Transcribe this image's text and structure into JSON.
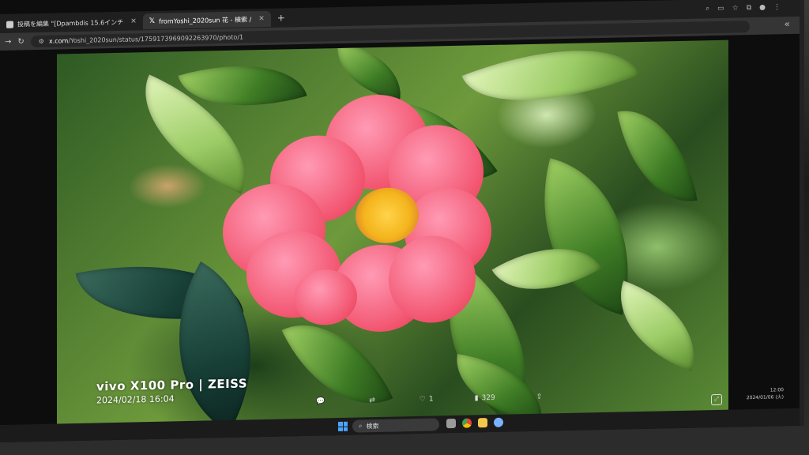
{
  "browser": {
    "tabs": [
      {
        "label": "投稿を編集 \"[Dpambdis 15.6インチ",
        "active": false
      },
      {
        "label": "fromYoshi_2020sun 花 - 検索 /",
        "active": true
      }
    ],
    "new_tab": "+",
    "url_prefix": "x.com",
    "url_rest": "/Yoshi_2020sun/status/1759173969092263970/photo/1",
    "collapse": "«"
  },
  "photo": {
    "watermark_model": "vivo X100 Pro | ZEISS",
    "watermark_date": "2024/02/18 16:04"
  },
  "actions": {
    "reply": "",
    "repost": "",
    "like_count": "1",
    "views_count": "329",
    "share": ""
  },
  "taskbar": {
    "search_label": "検索",
    "time": "12:00",
    "date": "2024/01/06 (火)"
  },
  "colors": {
    "petal": "#f2546f",
    "stamen": "#f4b41c",
    "leaf": "#3f7d25",
    "start_accent": "#4aa4ff"
  }
}
